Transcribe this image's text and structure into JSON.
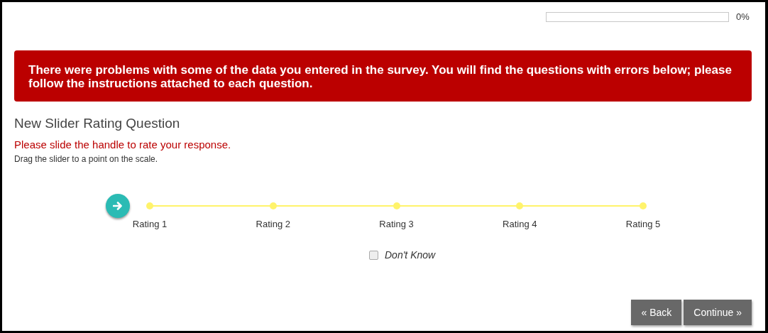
{
  "progress": {
    "level": 0,
    "reading": "0%"
  },
  "error_message": "There were problems with some of the data you entered in the survey. You will find the questions with errors below; please follow the instructions attached to each question.",
  "question": {
    "title": "New Slider Rating Question",
    "error": "Please slide the handle to rate your response.",
    "hint": "Drag the slider to a point on the scale.",
    "slider": {
      "points": [
        "Rating 1",
        "Rating 2",
        "Rating 3",
        "Rating 4",
        "Rating 5"
      ]
    },
    "dont_know": {
      "label": "Don't Know",
      "checked": false
    }
  },
  "buttons": [
    "« Back",
    "Continue »"
  ]
}
